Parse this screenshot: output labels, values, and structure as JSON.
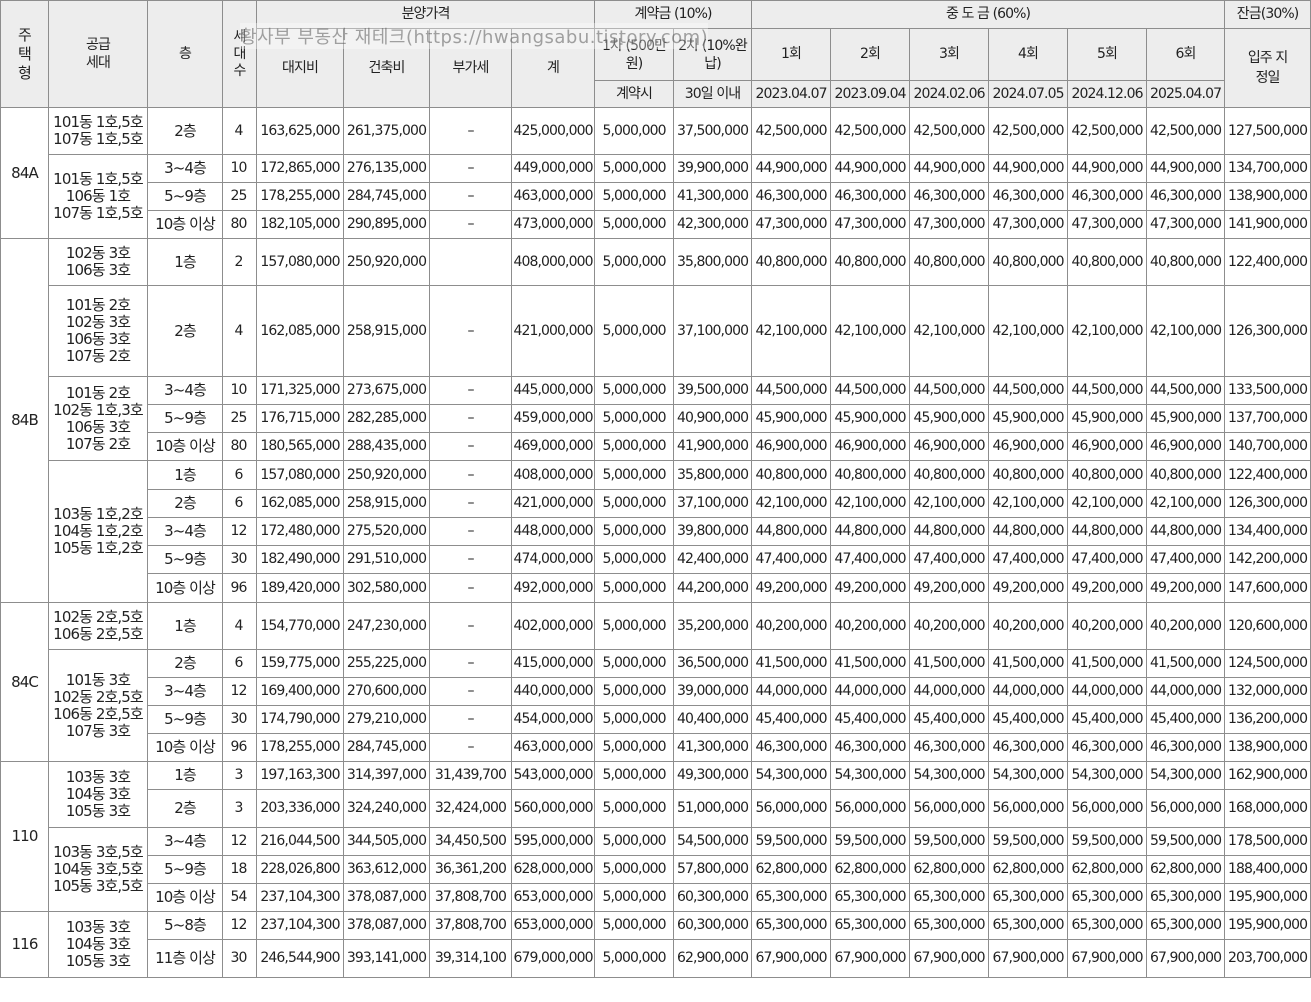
{
  "headers": {
    "type": "주택형",
    "units": "공급세대",
    "floor": "층",
    "households": "세대수",
    "sale_price": "분양가격",
    "land": "대지비",
    "building": "건축비",
    "vat": "부가세",
    "total": "계",
    "deposit": "계약금 (10%)",
    "dep1": "1차 (500만원)",
    "dep2": "2차 (10%완납)",
    "dep1_when": "계약시",
    "dep2_when": "30일 이내",
    "middle": "중 도 금 (60%)",
    "mid_rounds": [
      "1회",
      "2회",
      "3회",
      "4회",
      "5회",
      "6회"
    ],
    "mid_dates": [
      "2023.04.07",
      "2023.09.04",
      "2024.02.06",
      "2024.07.05",
      "2024.12.06",
      "2025.04.07"
    ],
    "balance": "잔금(30%)",
    "balance_when": "입주 지정일"
  },
  "watermark": "황사부 부동산 재테크(https://hwangsabu.tistory.com)",
  "rows": [
    {
      "type": "84A",
      "units": [
        "101동 1호,5호",
        "107동 1호,5호"
      ],
      "floor": "2층",
      "hh": "4",
      "land": "163,625,000",
      "build": "261,375,000",
      "vat": "–",
      "total": "425,000,000",
      "d1": "5,000,000",
      "d2": "37,500,000",
      "mid": "42,500,000",
      "bal": "127,500,000"
    },
    {
      "units": [
        "101동 1호,5호",
        "106동 1호",
        "107동 1호,5호"
      ],
      "floor": "3~4층",
      "hh": "10",
      "land": "172,865,000",
      "build": "276,135,000",
      "vat": "–",
      "total": "449,000,000",
      "d1": "5,000,000",
      "d2": "39,900,000",
      "mid": "44,900,000",
      "bal": "134,700,000"
    },
    {
      "floor": "5~9층",
      "hh": "25",
      "land": "178,255,000",
      "build": "284,745,000",
      "vat": "–",
      "total": "463,000,000",
      "d1": "5,000,000",
      "d2": "41,300,000",
      "mid": "46,300,000",
      "bal": "138,900,000"
    },
    {
      "floor": "10층 이상",
      "hh": "80",
      "land": "182,105,000",
      "build": "290,895,000",
      "vat": "–",
      "total": "473,000,000",
      "d1": "5,000,000",
      "d2": "42,300,000",
      "mid": "47,300,000",
      "bal": "141,900,000"
    },
    {
      "type": "84B",
      "units": [
        "102동 3호",
        "106동 3호"
      ],
      "floor": "1층",
      "hh": "2",
      "land": "157,080,000",
      "build": "250,920,000",
      "vat": "",
      "total": "408,000,000",
      "d1": "5,000,000",
      "d2": "35,800,000",
      "mid": "40,800,000",
      "bal": "122,400,000"
    },
    {
      "units": [
        "101동 2호",
        "102동 3호",
        "106동 3호",
        "107동 2호"
      ],
      "floor": "2층",
      "hh": "4",
      "land": "162,085,000",
      "build": "258,915,000",
      "vat": "–",
      "total": "421,000,000",
      "d1": "5,000,000",
      "d2": "37,100,000",
      "mid": "42,100,000",
      "bal": "126,300,000"
    },
    {
      "units": [
        "101동 2호",
        "102동 1호,3호",
        "106동 3호",
        "107동 2호"
      ],
      "floor": "3~4층",
      "hh": "10",
      "land": "171,325,000",
      "build": "273,675,000",
      "vat": "–",
      "total": "445,000,000",
      "d1": "5,000,000",
      "d2": "39,500,000",
      "mid": "44,500,000",
      "bal": "133,500,000"
    },
    {
      "floor": "5~9층",
      "hh": "25",
      "land": "176,715,000",
      "build": "282,285,000",
      "vat": "–",
      "total": "459,000,000",
      "d1": "5,000,000",
      "d2": "40,900,000",
      "mid": "45,900,000",
      "bal": "137,700,000"
    },
    {
      "floor": "10층 이상",
      "hh": "80",
      "land": "180,565,000",
      "build": "288,435,000",
      "vat": "–",
      "total": "469,000,000",
      "d1": "5,000,000",
      "d2": "41,900,000",
      "mid": "46,900,000",
      "bal": "140,700,000"
    },
    {
      "units": [
        "103동 1호,2호",
        "104동 1호,2호",
        "105동 1호,2호"
      ],
      "floor": "1층",
      "hh": "6",
      "land": "157,080,000",
      "build": "250,920,000",
      "vat": "–",
      "total": "408,000,000",
      "d1": "5,000,000",
      "d2": "35,800,000",
      "mid": "40,800,000",
      "bal": "122,400,000"
    },
    {
      "floor": "2층",
      "hh": "6",
      "land": "162,085,000",
      "build": "258,915,000",
      "vat": "–",
      "total": "421,000,000",
      "d1": "5,000,000",
      "d2": "37,100,000",
      "mid": "42,100,000",
      "bal": "126,300,000"
    },
    {
      "floor": "3~4층",
      "hh": "12",
      "land": "172,480,000",
      "build": "275,520,000",
      "vat": "–",
      "total": "448,000,000",
      "d1": "5,000,000",
      "d2": "39,800,000",
      "mid": "44,800,000",
      "bal": "134,400,000"
    },
    {
      "floor": "5~9층",
      "hh": "30",
      "land": "182,490,000",
      "build": "291,510,000",
      "vat": "–",
      "total": "474,000,000",
      "d1": "5,000,000",
      "d2": "42,400,000",
      "mid": "47,400,000",
      "bal": "142,200,000"
    },
    {
      "floor": "10층 이상",
      "hh": "96",
      "land": "189,420,000",
      "build": "302,580,000",
      "vat": "–",
      "total": "492,000,000",
      "d1": "5,000,000",
      "d2": "44,200,000",
      "mid": "49,200,000",
      "bal": "147,600,000"
    },
    {
      "type": "84C",
      "units": [
        "102동 2호,5호",
        "106동 2호,5호"
      ],
      "floor": "1층",
      "hh": "4",
      "land": "154,770,000",
      "build": "247,230,000",
      "vat": "–",
      "total": "402,000,000",
      "d1": "5,000,000",
      "d2": "35,200,000",
      "mid": "40,200,000",
      "bal": "120,600,000"
    },
    {
      "units": [
        "101동 3호",
        "102동 2호,5호",
        "106동 2호,5호",
        "107동 3호"
      ],
      "floor": "2층",
      "hh": "6",
      "land": "159,775,000",
      "build": "255,225,000",
      "vat": "–",
      "total": "415,000,000",
      "d1": "5,000,000",
      "d2": "36,500,000",
      "mid": "41,500,000",
      "bal": "124,500,000"
    },
    {
      "floor": "3~4층",
      "hh": "12",
      "land": "169,400,000",
      "build": "270,600,000",
      "vat": "–",
      "total": "440,000,000",
      "d1": "5,000,000",
      "d2": "39,000,000",
      "mid": "44,000,000",
      "bal": "132,000,000"
    },
    {
      "floor": "5~9층",
      "hh": "30",
      "land": "174,790,000",
      "build": "279,210,000",
      "vat": "–",
      "total": "454,000,000",
      "d1": "5,000,000",
      "d2": "40,400,000",
      "mid": "45,400,000",
      "bal": "136,200,000"
    },
    {
      "floor": "10층 이상",
      "hh": "96",
      "land": "178,255,000",
      "build": "284,745,000",
      "vat": "–",
      "total": "463,000,000",
      "d1": "5,000,000",
      "d2": "41,300,000",
      "mid": "46,300,000",
      "bal": "138,900,000"
    },
    {
      "type": "110",
      "units": [
        "103동 3호",
        "104동 3호",
        "105동 3호"
      ],
      "floor": "1층",
      "hh": "3",
      "land": "197,163,300",
      "build": "314,397,000",
      "vat": "31,439,700",
      "total": "543,000,000",
      "d1": "5,000,000",
      "d2": "49,300,000",
      "mid": "54,300,000",
      "bal": "162,900,000"
    },
    {
      "floor": "2층",
      "hh": "3",
      "land": "203,336,000",
      "build": "324,240,000",
      "vat": "32,424,000",
      "total": "560,000,000",
      "d1": "5,000,000",
      "d2": "51,000,000",
      "mid": "56,000,000",
      "bal": "168,000,000"
    },
    {
      "units": [
        "103동 3호,5호",
        "104동 3호,5호",
        "105동 3호,5호"
      ],
      "floor": "3~4층",
      "hh": "12",
      "land": "216,044,500",
      "build": "344,505,000",
      "vat": "34,450,500",
      "total": "595,000,000",
      "d1": "5,000,000",
      "d2": "54,500,000",
      "mid": "59,500,000",
      "bal": "178,500,000"
    },
    {
      "floor": "5~9층",
      "hh": "18",
      "land": "228,026,800",
      "build": "363,612,000",
      "vat": "36,361,200",
      "total": "628,000,000",
      "d1": "5,000,000",
      "d2": "57,800,000",
      "mid": "62,800,000",
      "bal": "188,400,000"
    },
    {
      "floor": "10층 이상",
      "hh": "54",
      "land": "237,104,300",
      "build": "378,087,000",
      "vat": "37,808,700",
      "total": "653,000,000",
      "d1": "5,000,000",
      "d2": "60,300,000",
      "mid": "65,300,000",
      "bal": "195,900,000"
    },
    {
      "type": "116",
      "units": [
        "103동 3호",
        "104동 3호",
        "105동 3호"
      ],
      "floor": "5~8층",
      "hh": "12",
      "land": "237,104,300",
      "build": "378,087,000",
      "vat": "37,808,700",
      "total": "653,000,000",
      "d1": "5,000,000",
      "d2": "60,300,000",
      "mid": "65,300,000",
      "bal": "195,900,000"
    },
    {
      "floor": "11층 이상",
      "hh": "30",
      "land": "246,544,900",
      "build": "393,141,000",
      "vat": "39,314,100",
      "total": "679,000,000",
      "d1": "5,000,000",
      "d2": "62,900,000",
      "mid": "67,900,000",
      "bal": "203,700,000"
    }
  ]
}
